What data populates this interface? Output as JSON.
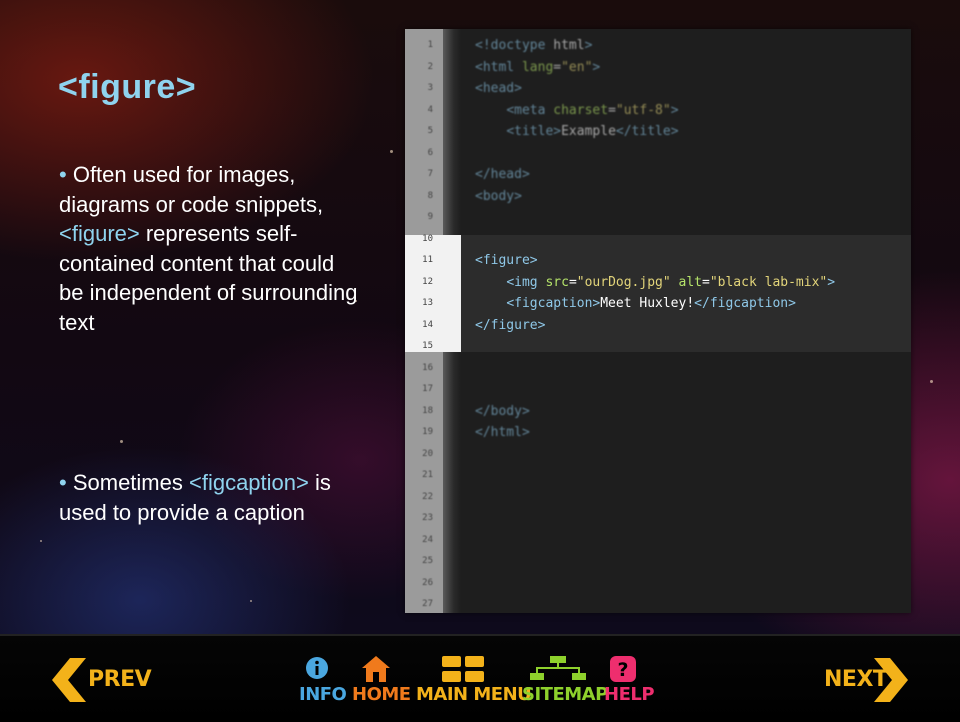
{
  "slide": {
    "title": "<figure>",
    "bullet1": {
      "text_a": "Often used for images, diagrams or code snippets, ",
      "tag": "<figure>",
      "text_b": " represents self-contained content that could be independent of surrounding text"
    },
    "bullet2": {
      "text_a": "Sometimes ",
      "tag": "<figcaption>",
      "text_b": " is used to provide a caption"
    }
  },
  "editor": {
    "line_numbers": [
      "1",
      "2",
      "3",
      "4",
      "5",
      "6",
      "7",
      "8",
      "9",
      "10",
      "11",
      "12",
      "13",
      "14",
      "15",
      "16",
      "17",
      "18",
      "19",
      "20",
      "21",
      "22",
      "23",
      "24",
      "25",
      "26",
      "27"
    ],
    "lines": [
      "<!doctype html>",
      "<html lang=\"en\">",
      "<head>",
      "    <meta charset=\"utf-8\">",
      "    <title>Example</title>",
      "",
      "</head>",
      "<body>",
      "",
      "",
      "<figure>",
      "    <img src=\"ourDog.jpg\" alt=\"black lab-mix\">",
      "    <figcaption>Meet Huxley!</figcaption>",
      "</figure>",
      "",
      "",
      "",
      "</body>",
      "</html>",
      "",
      "",
      "",
      "",
      "",
      "",
      "",
      ""
    ]
  },
  "nav": {
    "prev": "PREV",
    "info": "INFO",
    "home": "HOME",
    "main_menu": "MAIN MENU",
    "sitemap": "SITEMAP",
    "help": "HELP",
    "next": "NEXT",
    "colors": {
      "prev_next": "#f3b21a",
      "info": "#4aa7e0",
      "home": "#f07a1c",
      "main_menu": "#f3b21a",
      "sitemap": "#8ed12c",
      "help": "#ee2e6e"
    },
    "icons": [
      "chevron-left-icon",
      "info-icon",
      "home-icon",
      "grid-icon",
      "sitemap-icon",
      "help-icon",
      "chevron-right-icon"
    ]
  }
}
